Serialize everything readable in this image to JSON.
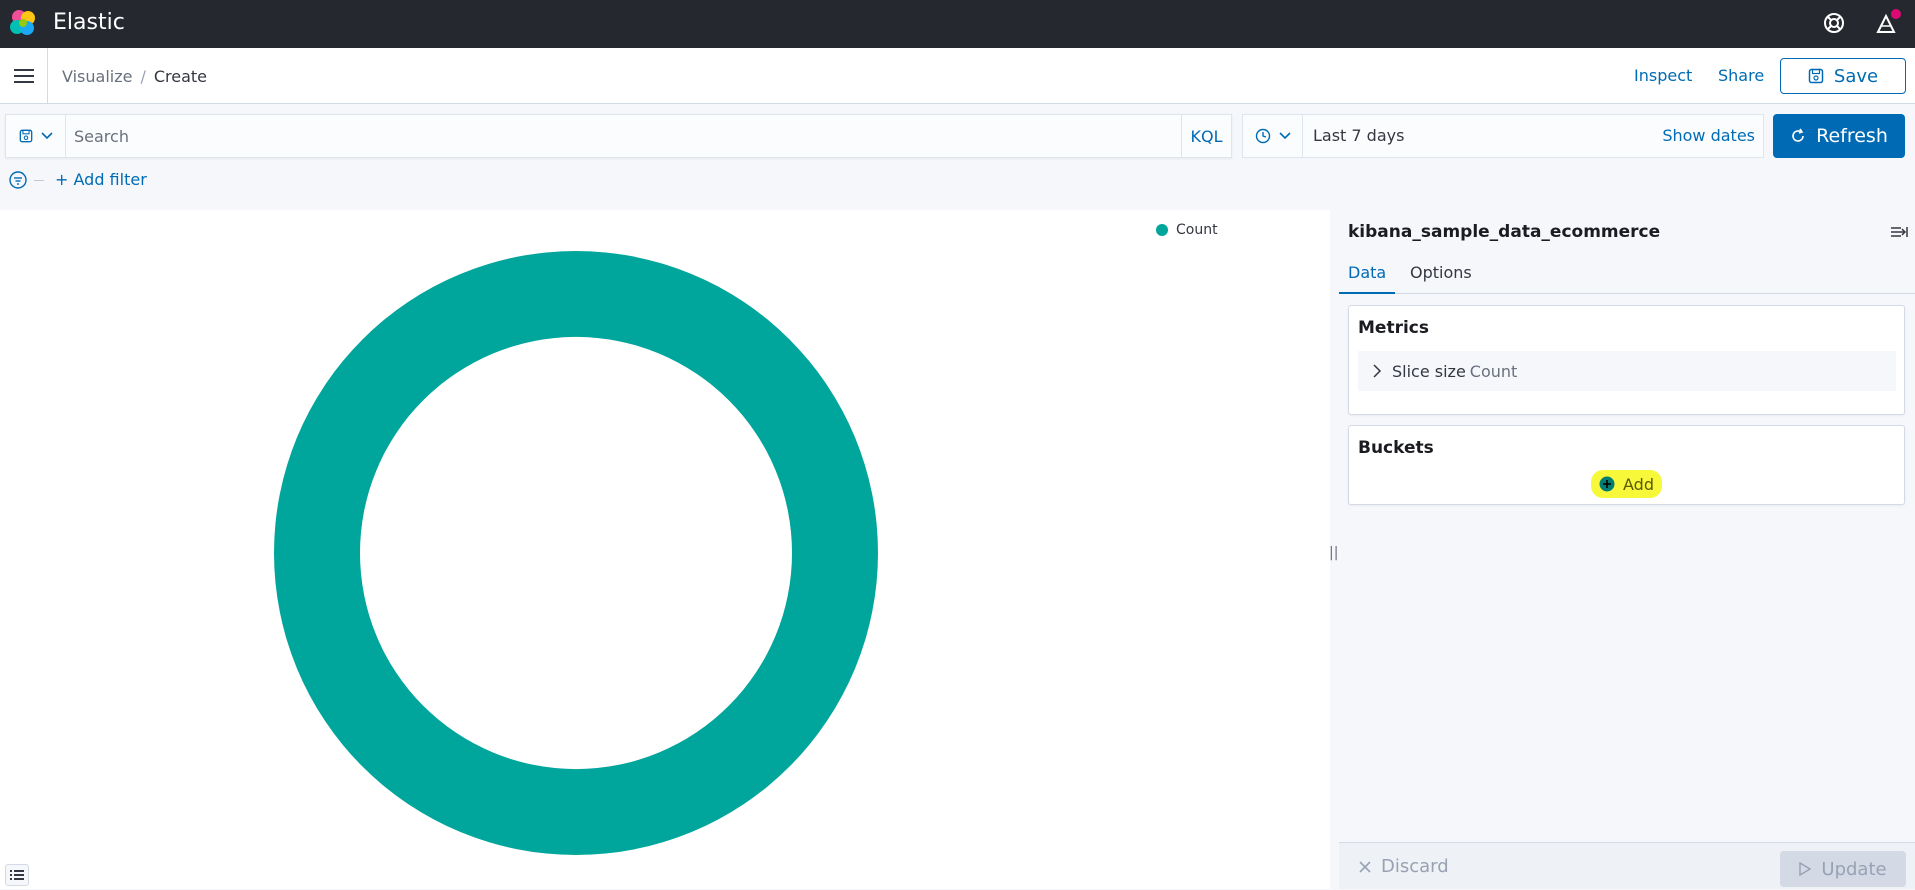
{
  "topbar": {
    "brand": "Elastic",
    "icons": [
      "elastic-logo-icon",
      "help-icon",
      "newsfeed-icon"
    ]
  },
  "header": {
    "breadcrumbs": [
      "Visualize",
      "Create"
    ],
    "breadcrumb_separator": "/",
    "inspect_label": "Inspect",
    "share_label": "Share",
    "save_label": "Save"
  },
  "query": {
    "placeholder": "Search",
    "language_label": "KQL"
  },
  "datepicker": {
    "range": "Last 7 days",
    "show_dates_label": "Show dates"
  },
  "refresh_label": "Refresh",
  "filters": {
    "add_filter_label": "+ Add filter"
  },
  "chart_data": {
    "type": "pie",
    "donut": true,
    "categories": [
      "Count"
    ],
    "values": [
      1
    ],
    "legend": {
      "position": "top-right",
      "entries": [
        "Count"
      ]
    },
    "colors": [
      "#00a69b"
    ]
  },
  "sidebar": {
    "index_pattern": "kibana_sample_data_ecommerce",
    "tabs": [
      "Data",
      "Options"
    ],
    "active_tab": "Data",
    "metrics": {
      "title": "Metrics",
      "agg_label": "Slice size",
      "agg_desc": "Count"
    },
    "buckets": {
      "title": "Buckets",
      "add_label": "Add"
    },
    "discard_label": "Discard",
    "update_label": "Update"
  },
  "colors": {
    "accent": "#006bb4",
    "topbar": "#25282f",
    "series": "#00a69b",
    "highlight": "#f8f83a"
  }
}
